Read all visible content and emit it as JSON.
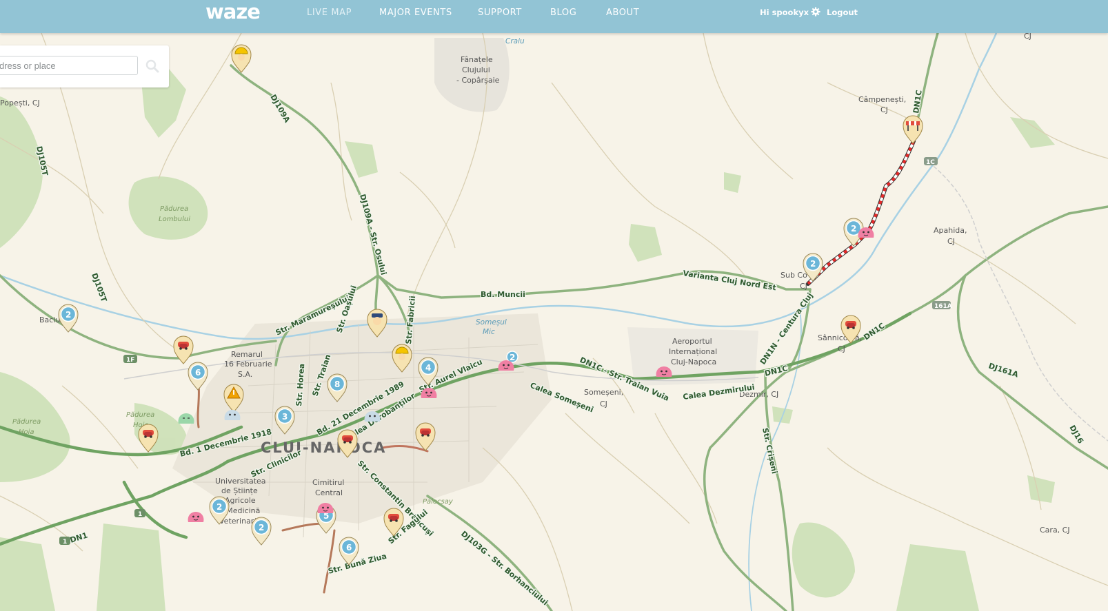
{
  "header": {
    "logo": "waze",
    "nav": [
      {
        "label": "LIVE MAP",
        "active": true
      },
      {
        "label": "MAJOR EVENTS"
      },
      {
        "label": "SUPPORT"
      },
      {
        "label": "BLOG"
      },
      {
        "label": "ABOUT"
      }
    ],
    "greeting": "Hi spookyx",
    "logout": "Logout"
  },
  "search": {
    "placeholder": "dress or place",
    "icon": "search-icon"
  },
  "map": {
    "city": "CLUJ-NAPOCA",
    "places": {
      "craiu": "Craiu",
      "fanatele": [
        "Fânațele",
        "Clujului",
        "- Copârșaie"
      ],
      "popesti": "Popești, CJ",
      "padurea_lombului": [
        "Pădurea",
        "Lombului"
      ],
      "baciu": "Baciu",
      "remarul": [
        "Remarul",
        "16 Februarie",
        "S.A."
      ],
      "padurea_hoia1": [
        "Pădurea",
        "Hoia"
      ],
      "padurea_hoia2": [
        "Pădurea",
        "Hoia"
      ],
      "campenesti": [
        "Câmpenești,",
        "CJ"
      ],
      "sub_coasta": [
        "Sub Co",
        "CJ"
      ],
      "apahida": [
        "Apahida,",
        "CJ"
      ],
      "sannicoara": [
        "Sânnico",
        "ă,",
        "CJ"
      ],
      "aeroportul": [
        "Aeroportul",
        "Internațional",
        "Cluj-Napoca"
      ],
      "somesu_mic": [
        "Someșul",
        "Mic"
      ],
      "someseni": [
        "Someșeni,",
        "CJ"
      ],
      "dezmir": "Dezmir, CJ",
      "cara": "Cara, CJ",
      "universitatea": [
        "Universitatea",
        "de Științe",
        "Agricole",
        "și Medicină",
        "Veterinară"
      ],
      "cimitirul": [
        "Cimitirul",
        "Central"
      ],
      "palocsay": "Palocsay",
      "cj_top": "CJ"
    },
    "roads": {
      "dj109a": "DJ109A",
      "dj105t_1": "DJ105T",
      "dj105t_2": "DJ105T",
      "dj109a_osului": "DJ109A - Str. Osului",
      "dn1c_top": "DN1C",
      "bd_muncii": "Bd. Muncii",
      "varianta": "Varianta Cluj Nord Est",
      "maramuresului": "Str. Maramureșului",
      "oasului": "Str. Oașului",
      "fabricii": "Str. Fabricii",
      "dn1n": "DN1N - Centura Cluj",
      "dn1c_right": "DN1C",
      "dj161a": "DJ161A",
      "dj16": "DJ16",
      "dn1c_vuia": "DN1C - Str. Traian Vuia",
      "calea_someseni": "Calea Someșeni",
      "calea_dezmirului": "Calea Dezmirului",
      "dn1c_mid": "DN1C",
      "horea": "Str. Horea",
      "traian": "Str. Traian",
      "bd_21": "Bd. 21 Decembrie 1989",
      "dorobantilor": "Calea Dorobanților",
      "aurel_vlaicu": "Str. Aurel Vlaicu",
      "bd_1_dec": "Bd. 1 Decembrie 1918",
      "clinicilor": "Str. Clinicilor",
      "brancusi": "Str. Constantin Brâncuși",
      "fagului": "Str. Fagului",
      "crisen": "Str. Crișeni",
      "dj103g": "DJ103G - Str. Borhanciului",
      "babes": "Str. Bună Ziua",
      "dn1": "DN1",
      "shield_1f": "1F",
      "shield_1c": "1C",
      "shield_161a": "161A",
      "shield_1a": "1",
      "shield_1b": "1"
    },
    "pin_counts": {
      "baciu": "2",
      "p6a": "6",
      "p8": "8",
      "p4": "4",
      "p2_center": "2",
      "p3": "3",
      "p2_univ": "2",
      "p2_south": "2",
      "p5": "5",
      "p6b": "6",
      "p2_sub1": "2",
      "p2_sub2": "2"
    }
  }
}
